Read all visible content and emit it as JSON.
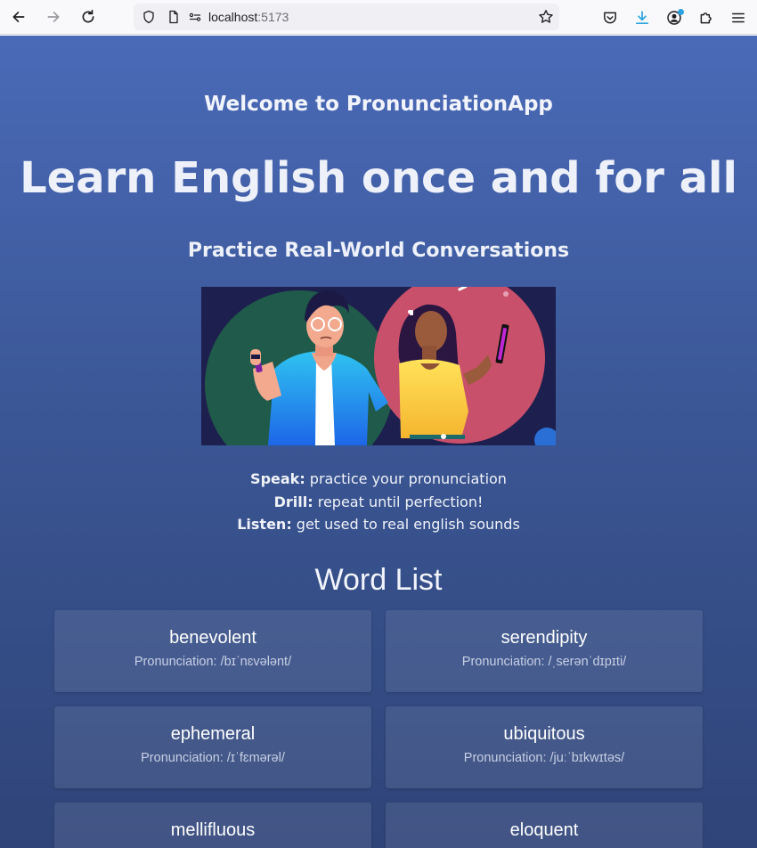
{
  "browser": {
    "url_host": "localhost",
    "url_port": ":5173"
  },
  "hero": {
    "welcome": "Welcome to PronunciationApp",
    "headline": "Learn English once and for all",
    "subhead": "Practice Real-World Conversations"
  },
  "features": [
    {
      "label": "Speak:",
      "text": " practice your pronunciation"
    },
    {
      "label": "Drill:",
      "text": " repeat until perfection!"
    },
    {
      "label": "Listen:",
      "text": " get used to real english sounds"
    }
  ],
  "word_list": {
    "title": "Word List",
    "pron_prefix": "Pronunciation: ",
    "words": [
      {
        "word": "benevolent",
        "pronunciation": "Pronunciation: /bɪˈnɛvələnt/"
      },
      {
        "word": "serendipity",
        "pronunciation": "Pronunciation: /ˌserənˈdɪpɪti/"
      },
      {
        "word": "ephemeral",
        "pronunciation": "Pronunciation: /ɪˈfɛmərəl/"
      },
      {
        "word": "ubiquitous",
        "pronunciation": "Pronunciation: /juːˈbɪkwɪtəs/"
      },
      {
        "word": "mellifluous",
        "pronunciation": ""
      },
      {
        "word": "eloquent",
        "pronunciation": ""
      }
    ]
  },
  "colors": {
    "page_top": "#4a6ab8",
    "page_bottom": "#2f4478",
    "card_bg": "rgba(255,255,255,0.09)"
  }
}
